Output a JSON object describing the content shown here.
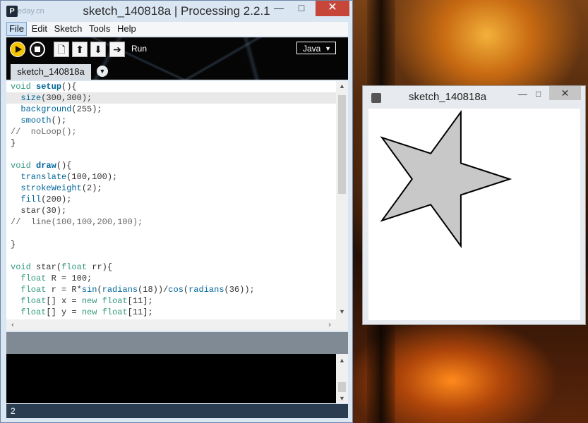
{
  "ide": {
    "title": "sketch_140818a | Processing 2.2.1",
    "watermark": "eday.cn",
    "app_icon_letter": "P",
    "menu": [
      "File",
      "Edit",
      "Sketch",
      "Tools",
      "Help"
    ],
    "run_label": "Run",
    "mode": "Java",
    "tab_name": "sketch_140818a",
    "status_line": "2"
  },
  "code_lines": [
    "void setup(){",
    "  size(300,300);",
    "  background(255);",
    "  smooth();",
    "//  noLoop();",
    "}",
    "",
    "void draw(){",
    "  translate(100,100);",
    "  strokeWeight(2);",
    "  fill(200);",
    "  star(30);",
    "//  line(100,100,200,100);",
    "",
    "}",
    "",
    "void star(float rr){",
    "  float R = 100;",
    "  float r = R*sin(radians(18))/cos(radians(36));",
    "  float[] x = new float[11];",
    "  float[] y = new float[11];"
  ],
  "current_line": 1,
  "sketch_window": {
    "title": "sketch_140818a",
    "star": {
      "fill": "#c8c8c8",
      "stroke": "#000000",
      "outer_radius": 100,
      "inner_radius_ratio": 0.382,
      "stroke_weight": 2
    }
  }
}
